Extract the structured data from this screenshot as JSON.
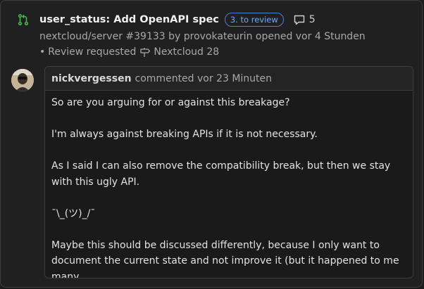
{
  "pr": {
    "title": "user_status: Add OpenAPI spec",
    "state_badge": "3. to review",
    "comment_count": "5",
    "meta_line": "nextcloud/server #39133 by provokateurin opened vor 4 Stunden",
    "review_prefix": "•",
    "review_text": "Review requested",
    "milestone": "Nextcloud 28",
    "icon": "pull-request-icon"
  },
  "comment": {
    "author": "nickvergessen",
    "time_text": "commented vor 23 Minuten",
    "paragraphs": [
      "So are you arguing for or against this breakage?",
      "I'm always against breaking APIs if it is not necessary.",
      "As I said I can also remove the compatibility break, but then we stay with this ugly API.",
      "¯\\_(ツ)_/¯",
      "Maybe this should be discussed differently, because I only want to document the current state and not improve it (but it happened to me many"
    ]
  },
  "colors": {
    "accent": "#4b7fd6",
    "pr_icon": "#3fb950",
    "background": "#202020"
  }
}
